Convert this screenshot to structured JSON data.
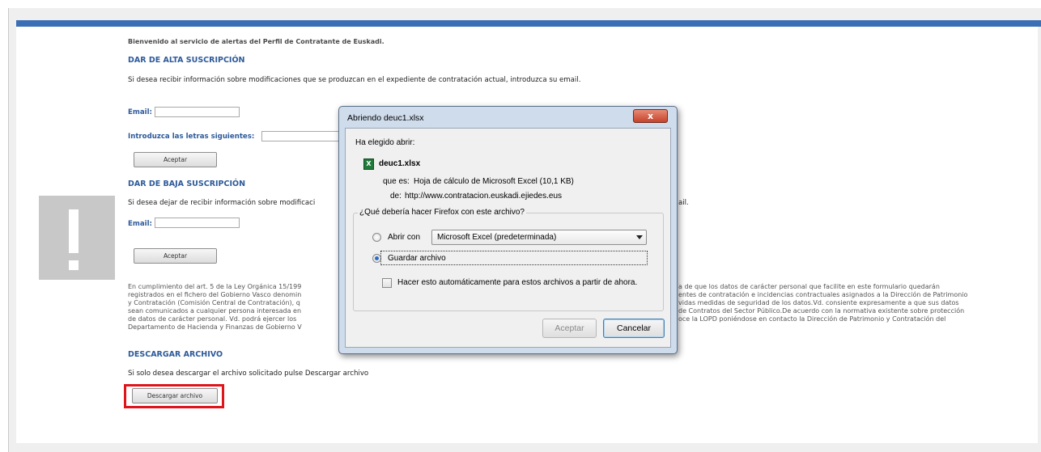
{
  "page": {
    "welcome": "Bienvenido al servicio de alertas del Perfil de Contratante de Euskadi.",
    "alta": {
      "heading": "DAR DE ALTA SUSCRIPCIÓN",
      "text": "Si desea recibir información sobre modificaciones que se produzcan en el expediente de contratación actual, introduzca su email.",
      "email_label": "Email:",
      "captcha_label": "Introduzca las letras siguientes:",
      "accept_label": "Aceptar"
    },
    "baja": {
      "heading": "DAR DE BAJA SUSCRIPCIÓN",
      "text": "Si desea dejar de recibir información sobre modificaci",
      "text_tail": "ail.",
      "email_label": "Email:",
      "accept_label": "Aceptar"
    },
    "legal": {
      "left": [
        "En cumplimiento del art. 5 de la Ley Orgánica 15/199",
        "registrados en el fichero del Gobierno Vasco denomin",
        "y Contratación (Comisión Central de Contratación), q",
        "sean comunicados a cualquier persona interesada en",
        "de datos de carácter personal. Vd. podrá ejercer los",
        "Departamento de Hacienda y Finanzas de Gobierno V"
      ],
      "right": [
        "a de que los datos de carácter personal que facilite en este formulario quedarán",
        "entes de contratación e incidencias contractuales asignados a la Dirección de Patrimonio",
        "vidas medidas de seguridad de los datos.Vd. consiente expresamente a que sus datos",
        "de Contratos del Sector Público.De acuerdo con la normativa existente sobre protección",
        "oce la LOPD poniéndose en contacto la Dirección de Patrimonio y Contratación del",
        ""
      ]
    },
    "descargar": {
      "heading": "DESCARGAR ARCHIVO",
      "text": "Si solo desea descargar el archivo solicitado pulse Descargar archivo",
      "button_label": "Descargar archivo"
    }
  },
  "dialog": {
    "title": "Abriendo deuc1.xlsx",
    "close_label": "x",
    "chosen_label": "Ha elegido abrir:",
    "file_icon": "X",
    "filename": "deuc1.xlsx",
    "type_label": "que es:",
    "type_value": "Hoja de cálculo de Microsoft Excel (10,1 KB)",
    "from_label": "de:",
    "from_value": "http://www.contratacion.euskadi.ejiedes.eus",
    "question": "¿Qué debería hacer Firefox con este archivo?",
    "open_with_label": "Abrir con",
    "open_with_app": "Microsoft Excel (predeterminada)",
    "save_label": "Guardar archivo",
    "auto_label": "Hacer esto automáticamente para estos archivos a partir de ahora.",
    "accept_label": "Aceptar",
    "cancel_label": "Cancelar",
    "selected_option": "save",
    "auto_checked": false
  },
  "colors": {
    "top_bar": "#3a6fb5",
    "heading": "#2d5a9a",
    "highlight": "#e0151c"
  }
}
